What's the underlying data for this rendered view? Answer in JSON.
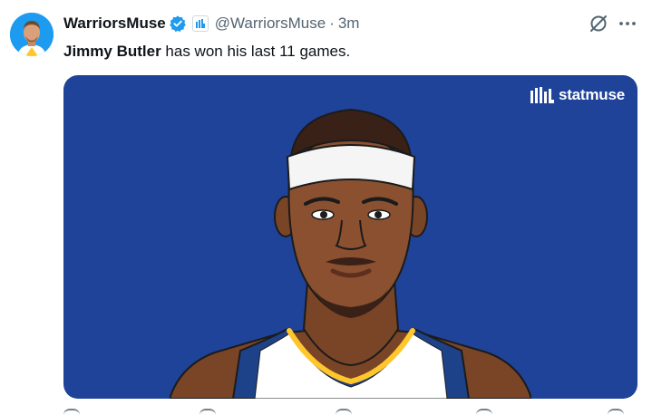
{
  "tweet": {
    "display_name": "WarriorsMuse",
    "handle": "@WarriorsMuse",
    "separator": "·",
    "time": "3m",
    "text_bold": "Jimmy Butler",
    "text_rest": " has won his last 11 games."
  },
  "media": {
    "brand_label": "statmuse",
    "brand_icon": "statmuse-logo-icon",
    "alt": "Jimmy Butler illustration"
  },
  "icons": {
    "verified": "verified-badge-icon",
    "affiliation": "affiliate-badge-icon",
    "grok": "grok-icon",
    "more": "more-icon"
  },
  "colors": {
    "media_background": "#1f4399",
    "verified_blue": "#1d9bf0",
    "jersey_blue": "#1d428a",
    "jersey_yellow": "#ffc72c",
    "secondary_text": "#536471"
  }
}
